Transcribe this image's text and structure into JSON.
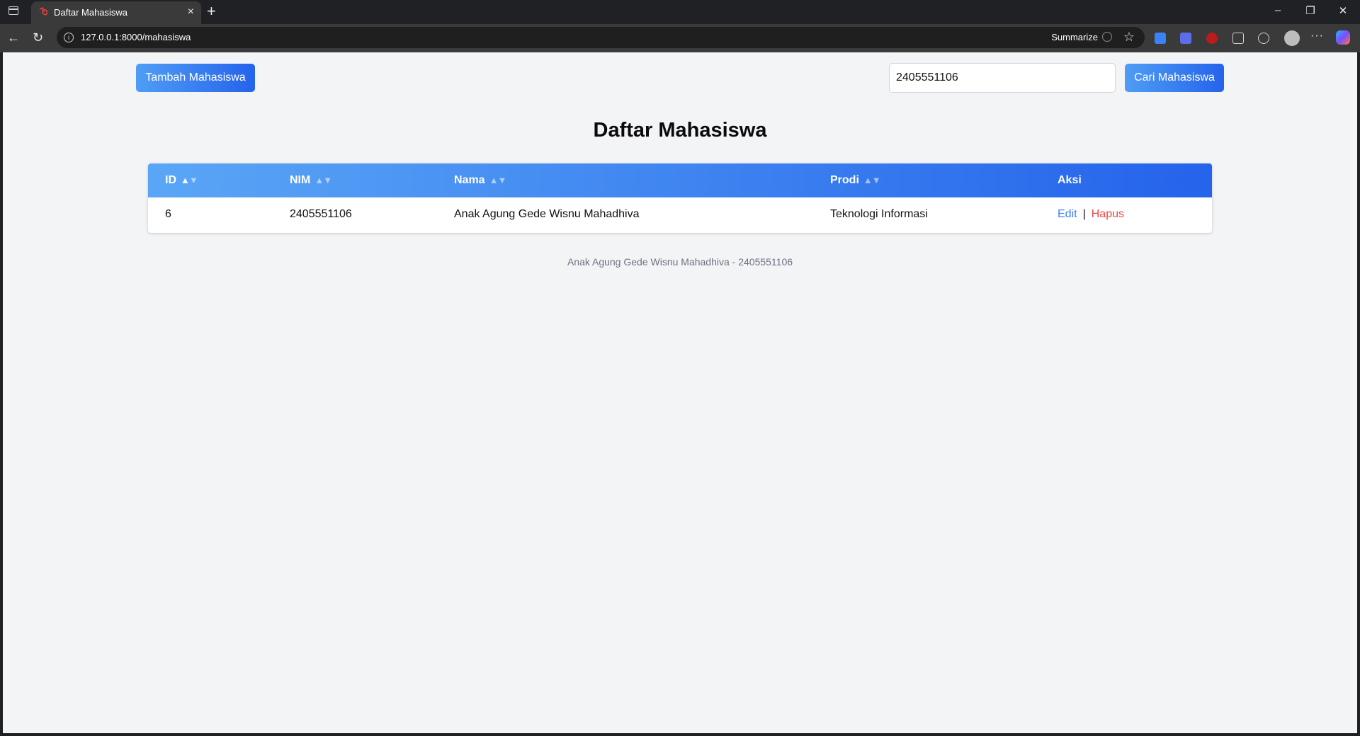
{
  "browser": {
    "tab_title": "Daftar Mahasiswa",
    "tab_close": "×",
    "new_tab": "+",
    "url": "127.0.0.1:8000/mahasiswa",
    "summarize": "Summarize",
    "window_controls": {
      "minimize": "–",
      "restore": "❐",
      "close": "✕"
    },
    "nav": {
      "back": "←",
      "reload": "↻"
    },
    "star": "☆",
    "menu": "···"
  },
  "actions": {
    "add_label": "Tambah Mahasiswa",
    "search_value": "2405551106",
    "search_label": "Cari Mahasiswa"
  },
  "page": {
    "title": "Daftar Mahasiswa",
    "footer": "Anak Agung Gede Wisnu Mahadhiva - 2405551106"
  },
  "table": {
    "headers": [
      "ID",
      "NIM",
      "Nama",
      "Prodi",
      "Aksi"
    ],
    "sort_up": "▲",
    "sort_down": "▼",
    "rows": [
      {
        "id": "6",
        "nim": "2405551106",
        "nama": "Anak Agung Gede Wisnu Mahadhiva",
        "prodi": "Teknologi Informasi",
        "edit": "Edit",
        "sep": "|",
        "hapus": "Hapus"
      }
    ]
  },
  "colors": {
    "primary": "#2563eb",
    "primary_light": "#4f9df5",
    "edit": "#3b82f6",
    "delete": "#ef4444",
    "background": "#f3f4f6"
  }
}
